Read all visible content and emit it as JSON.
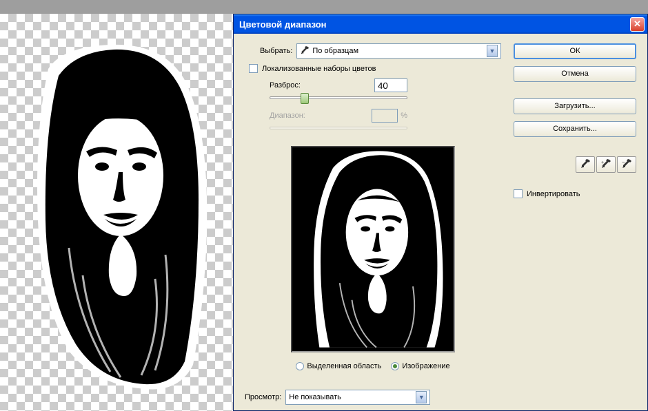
{
  "dialog": {
    "title": "Цветовой диапазон",
    "select_label": "Выбрать:",
    "select_value": "По образцам",
    "localized_checkbox_label": "Локализованные наборы цветов",
    "fuzziness_label": "Разброс:",
    "fuzziness_value": "40",
    "range_label": "Диапазон:",
    "range_unit": "%",
    "radio_selection_label": "Выделенная область",
    "radio_image_label": "Изображение",
    "preview_label": "Просмотр:",
    "preview_value": "Не показывать"
  },
  "buttons": {
    "ok": "ОК",
    "cancel": "Отмена",
    "load": "Загрузить...",
    "save": "Сохранить..."
  },
  "invert": {
    "label": "Инвертировать"
  },
  "close": "✕"
}
